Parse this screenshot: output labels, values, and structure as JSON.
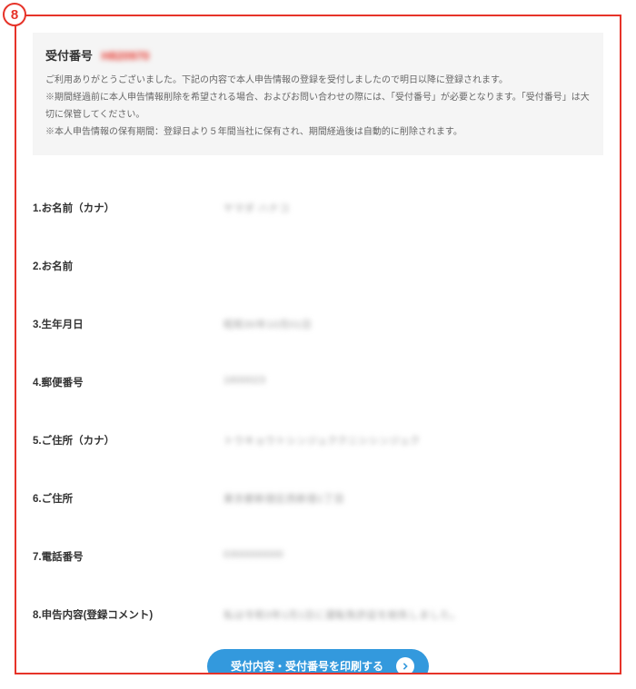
{
  "step": "8",
  "info_box": {
    "heading": "受付番号",
    "ref_number": "H820970",
    "line1": "ご利用ありがとうございました。下記の内容で本人申告情報の登録を受付しましたので明日以降に登録されます。",
    "line2": "※期間経過前に本人申告情報削除を希望される場合、およびお問い合わせの際には、「受付番号」が必要となります。「受付番号」は大切に保管してください。",
    "line3": "※本人申告情報の保有期間：登録日より５年間当社に保有され、期間経過後は自動的に削除されます。"
  },
  "fields": [
    {
      "label": "1.お名前（カナ）",
      "value": "ヤマダ ハナコ"
    },
    {
      "label": "2.お名前",
      "value": ""
    },
    {
      "label": "3.生年月日",
      "value": "昭和30年10月01日"
    },
    {
      "label": "4.郵便番号",
      "value": "1600023"
    },
    {
      "label": "5.ご住所（カナ）",
      "value": "トウキョウトシンジュククニシシンジュク"
    },
    {
      "label": "6.ご住所",
      "value": "東京都新宿区西新宿1丁目"
    },
    {
      "label": "7.電話番号",
      "value": "0300000000"
    },
    {
      "label": "8.申告内容(登録コメント)",
      "value": "私は令和3年1月1日に運転免許証を紛失しました。"
    }
  ],
  "print_button": "受付内容・受付番号を印刷する"
}
